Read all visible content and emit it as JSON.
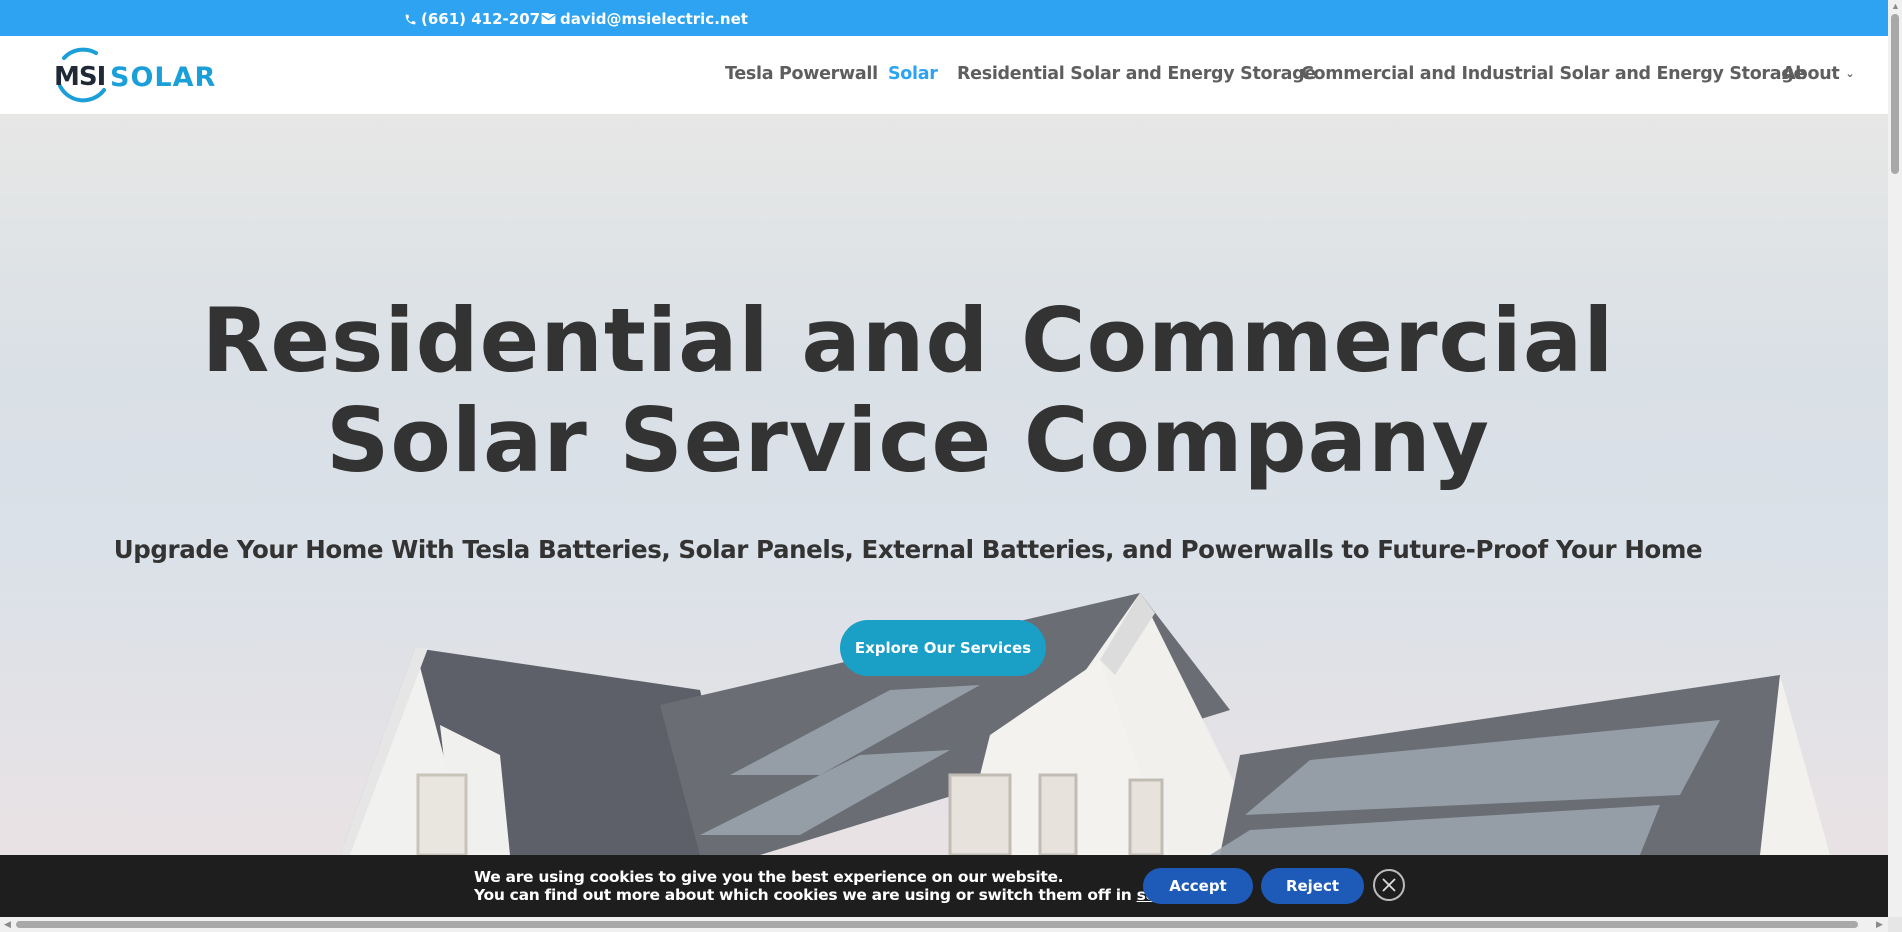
{
  "topbar": {
    "phone": "(661) 412-2075",
    "email": "david@msielectric.net",
    "icons": [
      "phone-icon",
      "email-icon"
    ],
    "bg_color": "#2ea3f2"
  },
  "logo": {
    "part1": "MSI",
    "part2": "SOLAR"
  },
  "nav": {
    "items": [
      {
        "label": "Tesla Powerwall",
        "active": false
      },
      {
        "label": "Solar",
        "active": true
      },
      {
        "label": "Residential Solar and Energy Storage",
        "active": false
      },
      {
        "label": "Commercial and Industrial Solar and Energy Storage",
        "active": false
      },
      {
        "label": "About",
        "active": false,
        "dropdown": true
      }
    ],
    "accent_color": "#2ea3f2"
  },
  "hero": {
    "title_line1": "Residential and Commercial",
    "title_line2": "Solar Service Company",
    "subtitle": "Upgrade Your Home With Tesla Batteries, Solar Panels, External Batteries, and Powerwalls to Future-Proof Your Home",
    "cta_label": "Explore Our Services",
    "cta_color": "#1a9fc7"
  },
  "cookie": {
    "line1": "We are using cookies to give you the best experience on our website.",
    "line2_prefix": "You can find out more about which cookies we are using or switch them off in ",
    "line2_link": "settings",
    "line2_suffix": ".",
    "accept_label": "Accept",
    "reject_label": "Reject",
    "close_icon": "close-icon",
    "button_color": "#1e5bb8"
  }
}
